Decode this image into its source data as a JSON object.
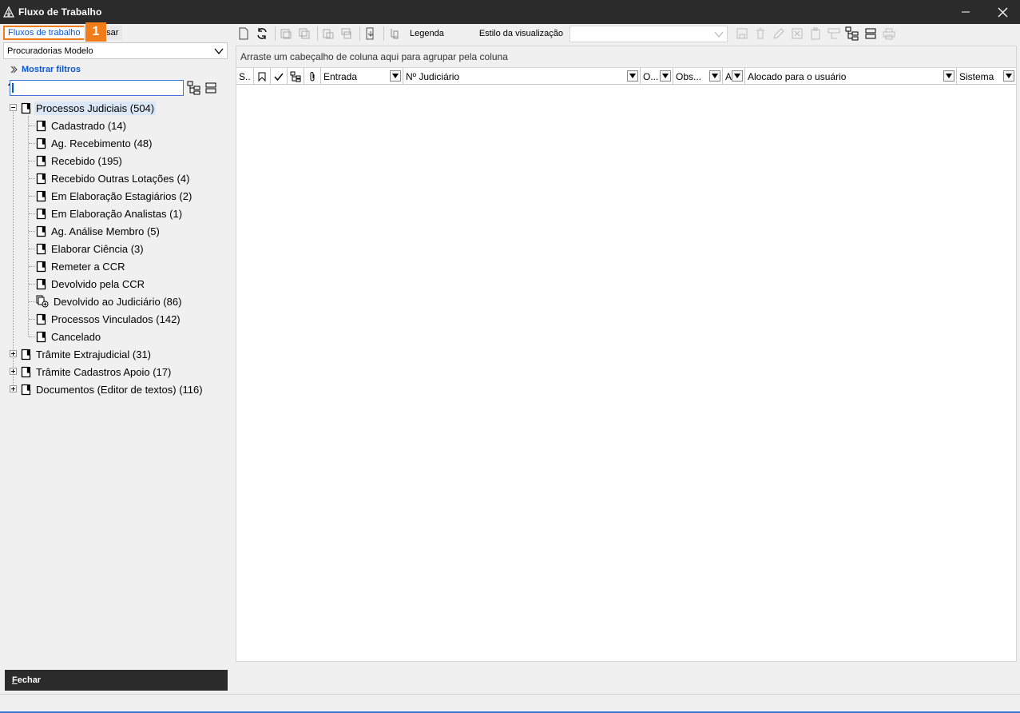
{
  "window": {
    "title": "Fluxo de Trabalho"
  },
  "left_panel": {
    "tabs": [
      {
        "label": "Fluxos de trabalho",
        "active": true
      },
      {
        "label": "Pesquisar",
        "active": false,
        "visible_text": "quisar"
      }
    ],
    "annotation_badge": "1",
    "workflow_combo": {
      "value": "Procuradorias Modelo"
    },
    "show_filters": "Mostrar filtros",
    "search": {
      "value": ""
    },
    "tree": [
      {
        "label": "Processos Judiciais (504)",
        "level": 0,
        "expanded": true,
        "selected": true,
        "children": [
          "Cadastrado (14)",
          "Ag. Recebimento (48)",
          "Recebido (195)",
          "Recebido Outras Lotações (4)",
          "Em Elaboração Estagiários (2)",
          "Em Elaboração Analistas (1)",
          "Ag. Análise Membro (5)",
          "Elaborar Ciência (3)",
          "Remeter a CCR",
          "Devolvido pela CCR",
          "Devolvido ao Judiciário (86)",
          "Processos Vinculados (142)",
          "Cancelado"
        ]
      },
      {
        "label": "Trâmite Extrajudicial (31)",
        "level": 0,
        "expanded": false
      },
      {
        "label": "Trâmite Cadastros Apoio (17)",
        "level": 0,
        "expanded": false
      },
      {
        "label": "Documentos (Editor de textos) (116)",
        "level": 0,
        "expanded": false
      }
    ],
    "close_button": {
      "first": "F",
      "rest": "echar"
    }
  },
  "toolbar": {
    "legend_label": "Legenda",
    "view_style_label": "Estilo da visualização",
    "view_style_value": ""
  },
  "grid": {
    "group_panel_text": "Arraste um cabeçalho de coluna aqui para agrupar pela coluna",
    "columns": [
      "S..",
      "",
      "",
      "",
      "",
      "Entrada",
      "Nº Judiciário",
      "O...",
      "Obs...",
      "A",
      "Alocado para o usuário",
      "Sistema"
    ]
  },
  "colors": {
    "accent_orange": "#f07d1a",
    "link_blue": "#0b57d0",
    "titlebar": "#2b2b2b"
  }
}
